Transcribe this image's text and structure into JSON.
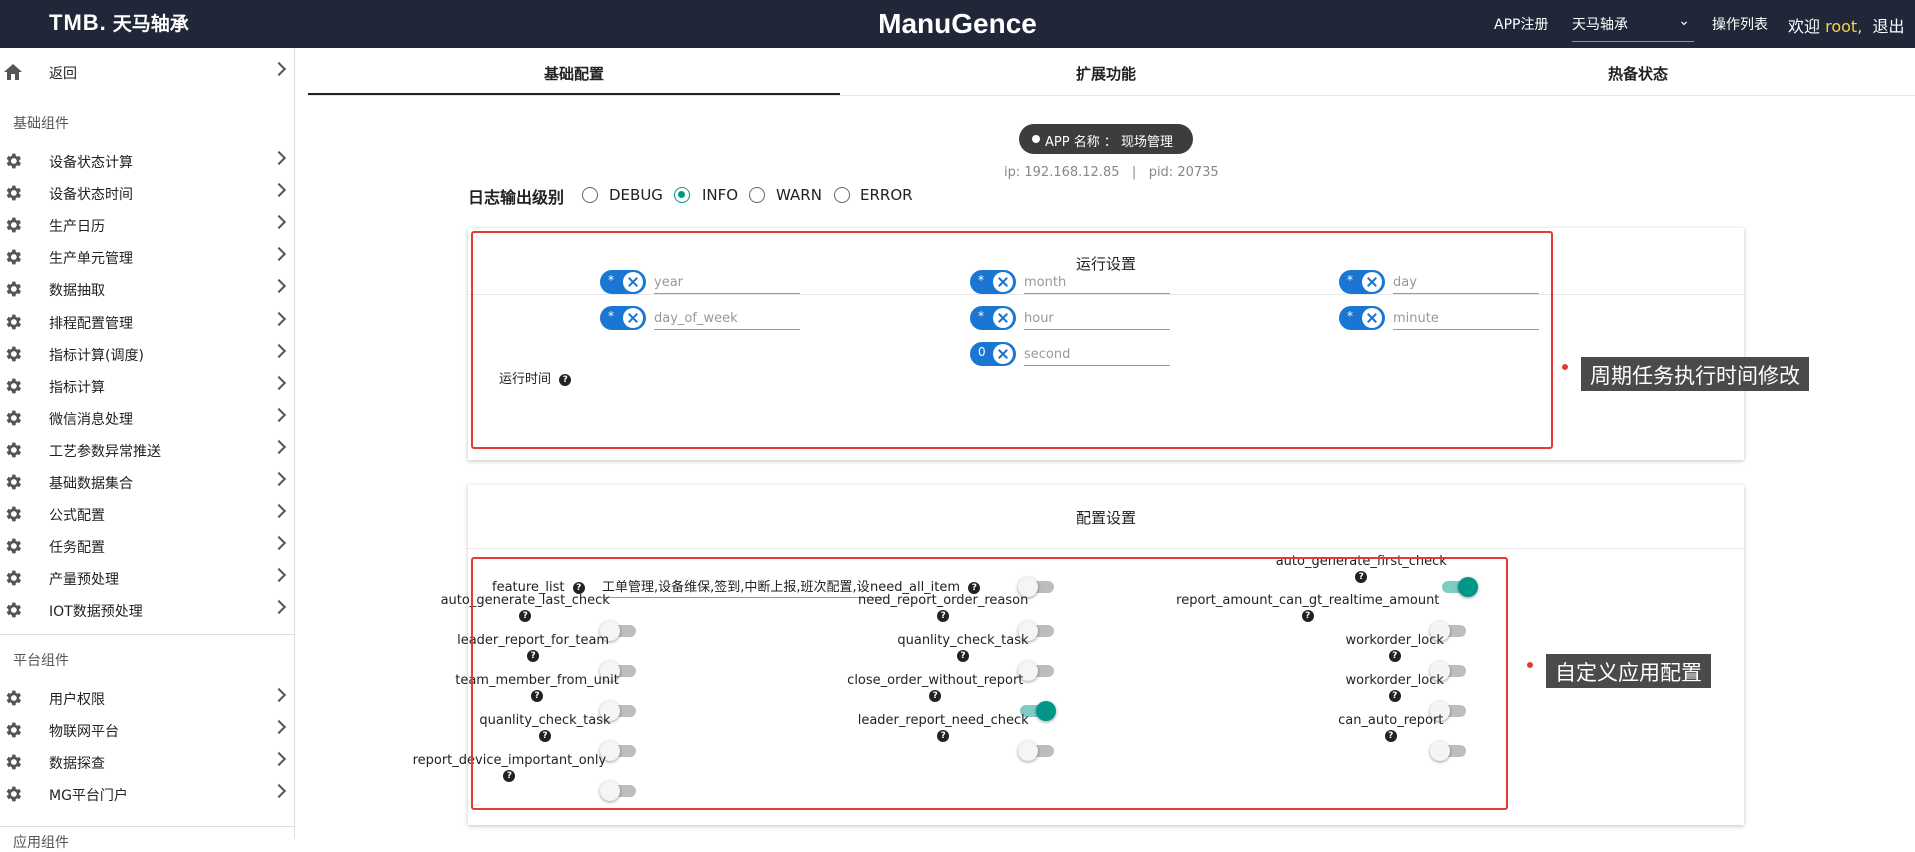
{
  "header": {
    "logo": "TMB.",
    "logo_cn": "天马轴承",
    "title": "ManuGence",
    "app_register": "APP注册",
    "factory_select": "天马轴承",
    "operation_list": "操作列表",
    "welcome": "欢迎",
    "user": "root,",
    "logout": "退出"
  },
  "sidebar": {
    "back": "返回",
    "section1": "基础组件",
    "items1": [
      "设备状态计算",
      "设备状态时间",
      "生产日历",
      "生产单元管理",
      "数据抽取",
      "排程配置管理",
      "指标计算(调度)",
      "指标计算",
      "微信消息处理",
      "工艺参数异常推送",
      "基础数据集合",
      "公式配置",
      "任务配置",
      "产量预处理",
      "IOT数据预处理"
    ],
    "section2": "平台组件",
    "items2": [
      "用户权限",
      "物联网平台",
      "数据探查",
      "MG平台门户"
    ],
    "section3": "应用组件"
  },
  "tabs": [
    "基础配置",
    "扩展功能",
    "热备状态"
  ],
  "app": {
    "name": "APP 名称 ： 现场管理",
    "ip": "ip: 192.168.12.85",
    "sep": "|",
    "pid": "pid: 20735"
  },
  "log": {
    "label": "日志输出级别",
    "levels": [
      "DEBUG",
      "INFO",
      "WARN",
      "ERROR"
    ],
    "selected": "INFO"
  },
  "run": {
    "title": "运行设置",
    "label": "运行时间",
    "help": "?",
    "fields": [
      {
        "v": "*",
        "p": "year"
      },
      {
        "v": "*",
        "p": "month"
      },
      {
        "v": "*",
        "p": "day"
      },
      {
        "v": "*",
        "p": "day_of_week"
      },
      {
        "v": "*",
        "p": "hour"
      },
      {
        "v": "*",
        "p": "minute"
      },
      {
        "v": "0",
        "p": "second"
      }
    ]
  },
  "config": {
    "title": "配置设置",
    "help": "?",
    "feature_list": {
      "label": "feature_list",
      "value": "工单管理,设备维保,签到,中断上报,班次配置,设"
    },
    "switches": [
      {
        "label": "need_all_item",
        "on": false
      },
      {
        "label": "auto_generate_first_check",
        "on": true
      },
      {
        "label": "auto_generate_last_check",
        "on": false
      },
      {
        "label": "need_report_order_reason",
        "on": false
      },
      {
        "label": "report_amount_can_gt_realtime_amount",
        "on": false
      },
      {
        "label": "leader_report_for_team",
        "on": false
      },
      {
        "label": "quanlity_check_task",
        "on": false
      },
      {
        "label": "workorder_lock",
        "on": false
      },
      {
        "label": "team_member_from_unit",
        "on": false
      },
      {
        "label": "close_order_without_report",
        "on": true
      },
      {
        "label": "workorder_lock",
        "on": false
      },
      {
        "label": "quanlity_check_task",
        "on": false
      },
      {
        "label": "leader_report_need_check",
        "on": false
      },
      {
        "label": "can_auto_report",
        "on": false
      },
      {
        "label": "report_device_important_only",
        "on": false
      }
    ]
  },
  "callouts": {
    "run": "周期任务执行时间修改",
    "config": "自定义应用配置"
  },
  "colors": {
    "topbar": "#1f2738",
    "accent": "#009688",
    "chip": "#1976d2",
    "highlight": "#e53935"
  }
}
